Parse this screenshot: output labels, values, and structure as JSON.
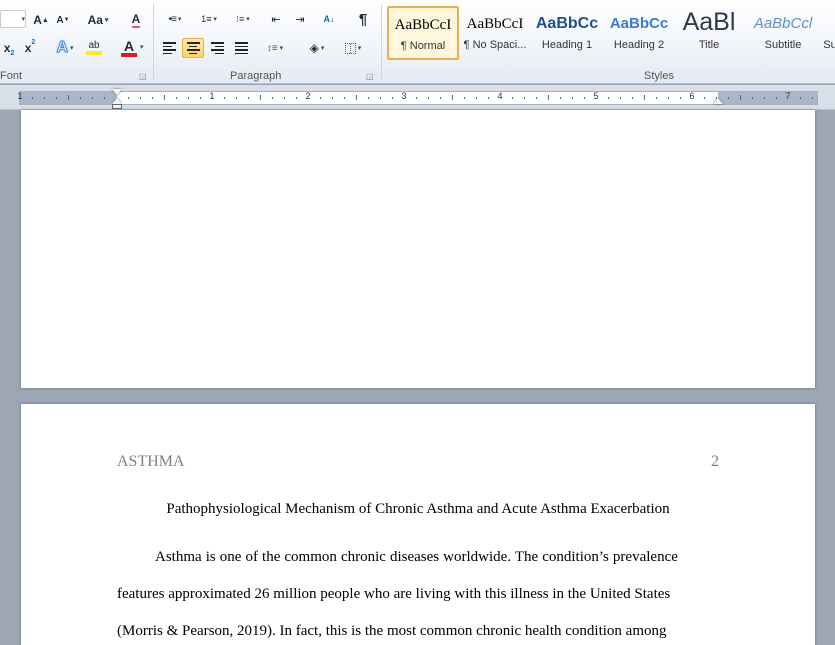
{
  "ribbon": {
    "font_group": {
      "label": "Font",
      "grow_font": "A",
      "shrink_font": "A",
      "change_case": "Aa",
      "clear_formatting": "A",
      "subscript": "x",
      "subscript_mark": "2",
      "superscript": "x",
      "superscript_mark": "2",
      "text_effects": "A",
      "highlight": "ab",
      "font_color": "A",
      "font_color_hex": "#d81e1e",
      "highlight_hex": "#f5f01a"
    },
    "paragraph_group": {
      "label": "Paragraph",
      "show_marks": "¶",
      "active_alignment": "center"
    },
    "styles_group": {
      "label": "Styles",
      "tiles": [
        {
          "sample": "AaBbCcI",
          "name": "¶ Normal",
          "selected": true
        },
        {
          "sample": "AaBbCcI",
          "name": "¶ No Spaci..."
        },
        {
          "sample": "AaBbCc",
          "name": "Heading 1"
        },
        {
          "sample": "AaBbCc",
          "name": "Heading 2"
        },
        {
          "sample": "AaBl",
          "name": "Title"
        },
        {
          "sample": "AaBbCcl",
          "name": "Subtitle"
        },
        {
          "sample": "",
          "name": "Su"
        }
      ]
    }
  },
  "ruler": {
    "numbers": [
      "1",
      "1",
      "2",
      "3",
      "4",
      "5",
      "6",
      "7"
    ]
  },
  "document": {
    "running_head": "ASTHMA",
    "page_number": "2",
    "title": "Pathophysiological  Mechanism  of Chronic Asthma and Acute Asthma Exacerbation",
    "lines": [
      "Asthma is one of the common  chronic  diseases worldwide. The condition’s prevalence",
      "features approximated 26 million  people who are living with this illness  in the United States",
      "(Morris  &  Pearson,  2019).  In fact, this is the most  common  chronic health condition among"
    ]
  }
}
